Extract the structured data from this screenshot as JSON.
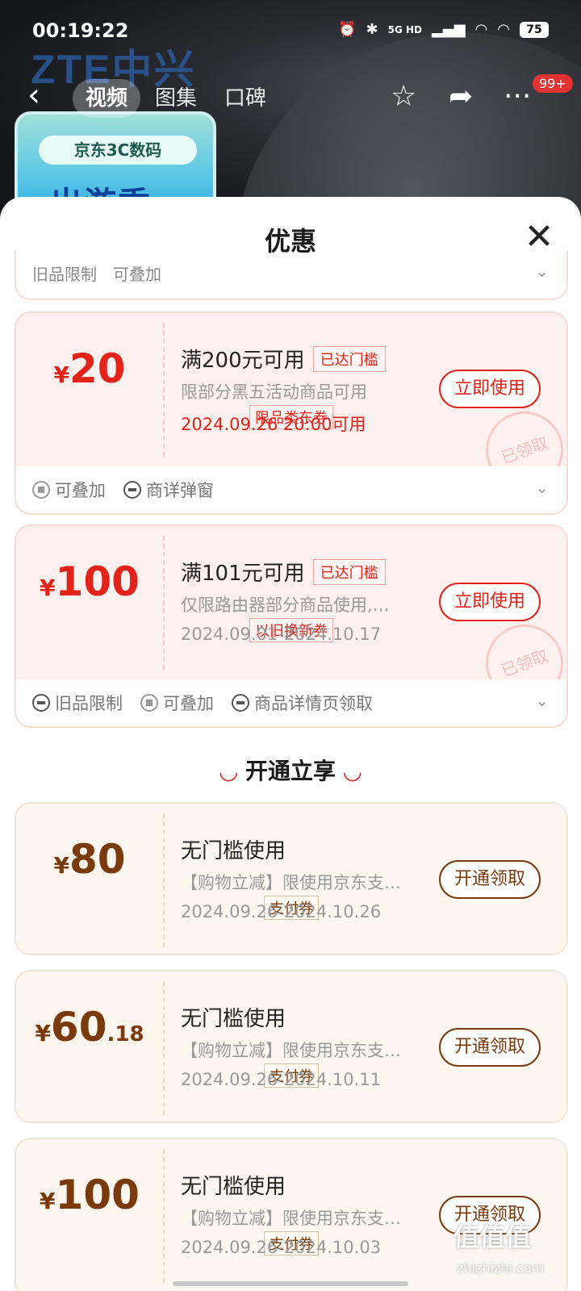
{
  "status_bar": {
    "time": "00:19:22",
    "network": "5G HD",
    "battery": "75"
  },
  "background": {
    "brand_logo": "ZTE中兴",
    "promo_title": "京东3C数码",
    "promo_big": "出游季"
  },
  "nav": {
    "tabs": [
      {
        "label": "视频",
        "active": true
      },
      {
        "label": "图集",
        "active": false
      },
      {
        "label": "口碑",
        "active": false
      }
    ],
    "badge": "99+"
  },
  "sheet": {
    "title": "优惠",
    "peek_tags": [
      "旧品限制",
      "可叠加"
    ],
    "coupons": [
      {
        "currency": "¥",
        "amount": "20",
        "decimal": "",
        "type_label": "限品类东券",
        "condition": "满200元可用",
        "status_tag": "已达门槛",
        "description": "限部分黑五活动商品可用",
        "date": "2024.09.26 20:00可用",
        "button": "立即使用",
        "stamp": "已领取",
        "tags": [
          "可叠加",
          "商详弹窗"
        ]
      },
      {
        "currency": "¥",
        "amount": "100",
        "decimal": "",
        "type_label": "以旧换新券",
        "condition": "满101元可用",
        "status_tag": "已达门槛",
        "description": "仅限路由器部分商品使用,…",
        "date": "2024.09.01-2024.10.17",
        "button": "立即使用",
        "stamp": "已领取",
        "tags": [
          "旧品限制",
          "可叠加",
          "商品详情页领取"
        ]
      }
    ],
    "section_title": "开通立享",
    "pay_coupons": [
      {
        "currency": "¥",
        "amount": "80",
        "decimal": "",
        "type_label": "支付券",
        "condition": "无门槛使用",
        "description": "【购物立减】限使用京东支…",
        "date": "2024.09.26-2024.10.26",
        "button": "开通领取"
      },
      {
        "currency": "¥",
        "amount": "60",
        "decimal": ".18",
        "type_label": "支付券",
        "condition": "无门槛使用",
        "description": "【购物立减】限使用京东支…",
        "date": "2024.09.26-2024.10.11",
        "button": "开通领取"
      },
      {
        "currency": "¥",
        "amount": "100",
        "decimal": "",
        "type_label": "支付券",
        "condition": "无门槛使用",
        "description": "【购物立减】限使用京东支…",
        "date": "2024.09.26-2024.10.03",
        "button": "开通领取"
      }
    ]
  },
  "watermark": {
    "text": "值值值",
    "site": "zhizhizhi.com"
  },
  "colors": {
    "accent_red": "#e2231a",
    "pay_brown": "#7a3a0c"
  }
}
